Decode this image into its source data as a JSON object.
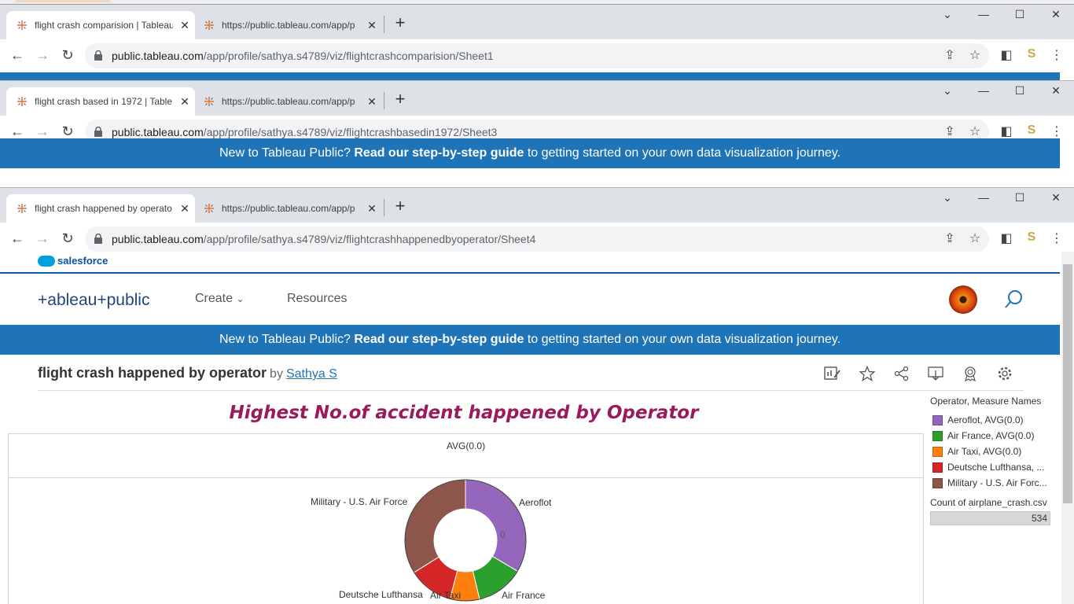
{
  "browser_windows": [
    {
      "tab_active_title": "flight crash comparision | Tableau",
      "tab_second_title": "https://public.tableau.com/app/p",
      "url_domain": "public.tableau.com",
      "url_path": "/app/profile/sathya.s4789/viz/flightcrashcomparision/Sheet1"
    },
    {
      "tab_active_title": "flight crash based in 1972 | Table",
      "tab_second_title": "https://public.tableau.com/app/p",
      "url_domain": "public.tableau.com",
      "url_path": "/app/profile/sathya.s4789/viz/flightcrashbasedin1972/Sheet3"
    },
    {
      "tab_active_title": "flight crash happened by operato",
      "tab_second_title": "https://public.tableau.com/app/p",
      "url_domain": "public.tableau.com",
      "url_path": "/app/profile/sathya.s4789/viz/flightcrashhappenedbyoperator/Sheet4"
    }
  ],
  "banner": {
    "prefix": "New to Tableau Public?",
    "link": "Read our step-by-step guide",
    "suffix": "to getting started on your own data visualization journey."
  },
  "salesforce_label": "salesforce",
  "header": {
    "logo_text": "+ableau+public",
    "nav_create": "Create",
    "nav_resources": "Resources"
  },
  "viz": {
    "title": "flight crash happened by operator",
    "by_label": "by",
    "author": "Sathya S"
  },
  "chart_title": "Highest No.of accident happened by Operator",
  "column_header": "AVG(0.0)",
  "center_label": "0",
  "chart_data": {
    "type": "pie",
    "title": "Highest No.of accident happened by Operator",
    "column_header": "AVG(0.0)",
    "categories": [
      "Aeroflot",
      "Air France",
      "Air Taxi",
      "Deutsche Lufthansa",
      "Military - U.S. Air Force"
    ],
    "values": [
      179,
      68,
      42,
      64,
      181
    ],
    "colors": [
      "#9467bd",
      "#2ca02c",
      "#ff7f0e",
      "#d62728",
      "#8c564b"
    ],
    "donut": true
  },
  "legend": {
    "title": "Operator, Measure Names",
    "items": [
      {
        "label": "Aeroflot, AVG(0.0)",
        "color": "#9467bd"
      },
      {
        "label": "Air France, AVG(0.0)",
        "color": "#2ca02c"
      },
      {
        "label": "Air Taxi, AVG(0.0)",
        "color": "#ff7f0e"
      },
      {
        "label": "Deutsche Lufthansa, ...",
        "color": "#d62728"
      },
      {
        "label": "Military - U.S. Air Forc...",
        "color": "#8c564b"
      }
    ],
    "count_title": "Count of airplane_crash.csv",
    "count_value": "534"
  }
}
